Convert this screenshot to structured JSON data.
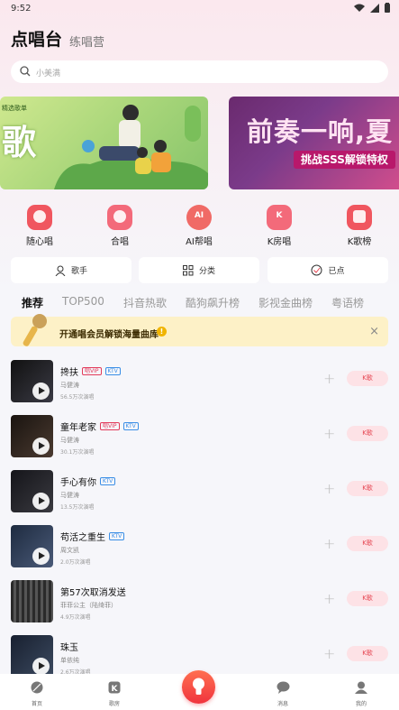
{
  "status_bar": {
    "time": "9:52"
  },
  "header": {
    "title": "点唱台",
    "second_tab": "练唱营"
  },
  "search": {
    "placeholder": "小美满"
  },
  "banners": [
    {
      "tag": "精选歌单",
      "headline": "歌"
    },
    {
      "headline": "前奏一响,夏",
      "pill": "挑战SSS解锁特权"
    }
  ],
  "quick_entries": [
    {
      "label": "随心唱",
      "icon": "heart-mic-icon",
      "color": "#f0565f"
    },
    {
      "label": "合唱",
      "icon": "group-mic-icon",
      "color": "#f36a7a"
    },
    {
      "label": "AI帮唱",
      "icon": "ai-badge-icon",
      "color": "#f06a66",
      "icon_text": "AI"
    },
    {
      "label": "K房唱",
      "icon": "k-room-icon",
      "color": "#f36a7a",
      "icon_text": "K"
    },
    {
      "label": "K歌榜",
      "icon": "trophy-icon",
      "color": "#f0565f"
    }
  ],
  "filters": [
    {
      "label": "歌手",
      "icon": "singer-icon"
    },
    {
      "label": "分类",
      "icon": "category-grid-icon"
    },
    {
      "label": "已点",
      "icon": "check-circle-icon"
    }
  ],
  "tabs": [
    "推荐",
    "TOP500",
    "抖音热歌",
    "酷狗飙升榜",
    "影视金曲榜",
    "粤语榜"
  ],
  "vip_bar": {
    "text": "开通唱会员解锁海量曲库",
    "info": "!",
    "close": "×"
  },
  "songs": [
    {
      "title": "搀扶",
      "vip": "唱VIP",
      "ktv": "KTV",
      "artist": "马健涛",
      "count": "56.5万次演唱",
      "action": "K歌",
      "cover_color": "#1b1b22"
    },
    {
      "title": "童年老家",
      "vip": "唱VIP",
      "ktv": "KTV",
      "artist": "马健涛",
      "count": "30.1万次演唱",
      "action": "K歌",
      "cover_color": "#2a2320"
    },
    {
      "title": "手心有你",
      "vip": "",
      "ktv": "KTV",
      "artist": "马健涛",
      "count": "13.5万次演唱",
      "action": "K歌",
      "cover_color": "#1e1d24"
    },
    {
      "title": "苟活之重生",
      "vip": "",
      "ktv": "KTV",
      "artist": "周文凯",
      "count": "2.0万次演唱",
      "action": "K歌",
      "cover_color": "#2c3a52"
    },
    {
      "title": "第57次取消发送",
      "vip": "",
      "ktv": "",
      "artist": "菲菲公主（陆绮菲）",
      "count": "4.9万次演唱",
      "action": "K歌",
      "cover_color": "#3a3a3a"
    },
    {
      "title": "珠玉",
      "vip": "",
      "ktv": "",
      "artist": "单依纯",
      "count": "2.6万次演唱",
      "action": "K歌",
      "cover_color": "#1f2a3a"
    }
  ],
  "bottom_nav": [
    {
      "label": "首页",
      "icon": "home-leaf-icon"
    },
    {
      "label": "歌房",
      "icon": "k-room-nav-icon"
    },
    {
      "label": "消息",
      "icon": "message-icon"
    },
    {
      "label": "我的",
      "icon": "profile-icon"
    }
  ],
  "colors": {
    "accent": "#f0343e",
    "vip_bg": "#fdf1c7",
    "ktv_blue": "#3a8ee6"
  }
}
